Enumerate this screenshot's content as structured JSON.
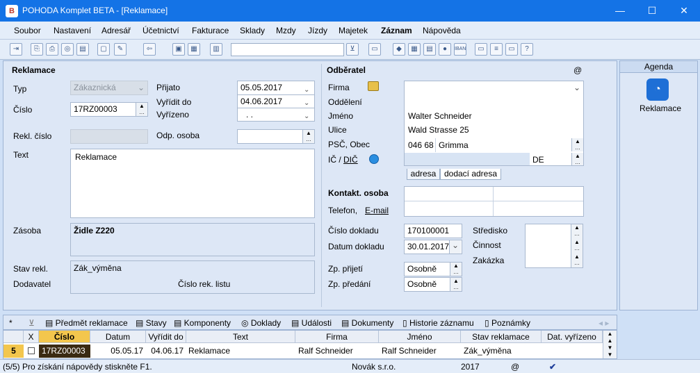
{
  "window": {
    "title": "POHODA Komplet BETA - [Reklamace]",
    "app_icon": "B",
    "min": "—",
    "max": "☐",
    "close": "✕"
  },
  "menu": [
    "Soubor",
    "Nastavení",
    "Adresář",
    "Účetnictví",
    "Fakturace",
    "Sklady",
    "Mzdy",
    "Jízdy",
    "Majetek",
    "Záznam",
    "Nápověda"
  ],
  "left": {
    "section": "Reklamace",
    "typ_label": "Typ",
    "typ_value": "Zákaznická",
    "cislo_label": "Číslo",
    "cislo_value": "17RZ00003",
    "prijato_label": "Přijato",
    "prijato_value": "05.05.2017",
    "vyridit_label": "Vyřídit do",
    "vyridit_value": "04.06.2017",
    "vyrizeno_label": "Vyřízeno",
    "vyrizeno_value": ". .",
    "rekl_cislo_label": "Rekl. číslo",
    "odp_osoba_label": "Odp. osoba",
    "text_label": "Text",
    "text_value": "Reklamace",
    "zasoba_label": "Zásoba",
    "zasoba_value": "Židle Z220",
    "stav_label": "Stav rekl.",
    "stav_value": "Zák_výměna",
    "dodavatel_label": "Dodavatel",
    "dodavatel_value": "Číslo rek. listu"
  },
  "right": {
    "section": "Odběratel",
    "at": "@",
    "firma_label": "Firma",
    "oddeleni_label": "Oddělení",
    "jmeno_label": "Jméno",
    "jmeno_value": "Walter Schneider",
    "ulice_label": "Ulice",
    "ulice_value": "Wald Strasse 25",
    "psc_label": "PSČ, Obec",
    "psc_value": "046 68",
    "obec_value": "Grimma",
    "ic_label": "IČ / ",
    "dic_label": "DIČ",
    "country": "DE",
    "tab_adresa": "adresa",
    "tab_dodaci": "dodací adresa",
    "kontakt_label": "Kontakt. osoba",
    "telefon_label": "Telefon,",
    "email_label": "E-mail",
    "cislo_dokladu_label": "Číslo dokladu",
    "cislo_dokladu_value": "170100001",
    "datum_dokladu_label": "Datum dokladu",
    "datum_dokladu_value": "30.01.2017",
    "stredisko_label": "Středisko",
    "cinnost_label": "Činnost",
    "zakazka_label": "Zakázka",
    "zp_prijeti_label": "Zp. přijetí",
    "zp_prijeti_value": "Osobně",
    "zp_predani_label": "Zp. předání",
    "zp_predani_value": "Osobně"
  },
  "agenda": {
    "title": "Agenda",
    "item": "Reklamace"
  },
  "bottom_tabs": [
    "*",
    "Předmět reklamace",
    "Stavy",
    "Komponenty",
    "Doklady",
    "Události",
    "Dokumenty",
    "Historie záznamu",
    "Poznámky"
  ],
  "grid": {
    "headers": [
      "X",
      "Číslo",
      "Datum",
      "Vyřídit do",
      "Text",
      "Firma",
      "Jméno",
      "Stav reklamace",
      "Dat. vyřízeno"
    ],
    "row": {
      "num": "5",
      "cislo": "17RZ00003",
      "datum": "05.05.17",
      "vyridit": "04.06.17",
      "text": "Reklamace",
      "firma": "Ralf Schneider",
      "jmeno": "Ralf Schneider",
      "stav": "Zák_výměna",
      "vyrizeno": ""
    }
  },
  "status": {
    "help": "(5/5) Pro získání nápovědy stiskněte F1.",
    "company": "Novák s.r.o.",
    "year": "2017",
    "at": "@"
  }
}
